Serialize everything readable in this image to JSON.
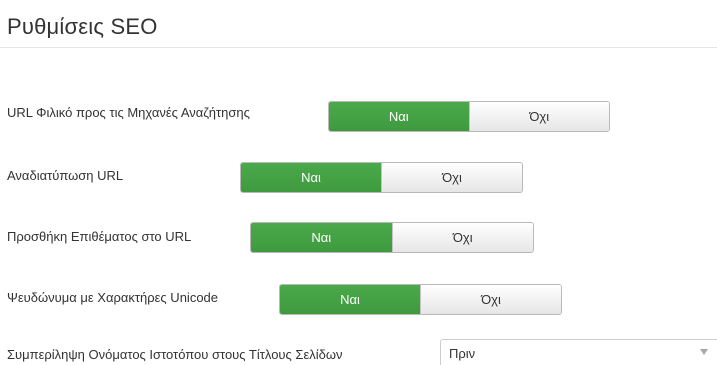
{
  "section": {
    "title": "Ρυθμίσεις SEO"
  },
  "colors": {
    "active": "#46a546",
    "inactive": "#f0f0f0"
  },
  "settings": [
    {
      "label": "URL Φιλικό προς τις Μηχανές Αναζήτησης",
      "yes_label": "Ναι",
      "no_label": "Όχι",
      "selected": "yes"
    },
    {
      "label": "Αναδιατύπωση URL",
      "yes_label": "Ναι",
      "no_label": "Όχι",
      "selected": "yes"
    },
    {
      "label": "Προσθήκη Επιθέματος στο URL",
      "yes_label": "Ναι",
      "no_label": "Όχι",
      "selected": "yes"
    },
    {
      "label": "Ψευδώνυμα με Χαρακτήρες Unicode",
      "yes_label": "Ναι",
      "no_label": "Όχι",
      "selected": "yes"
    }
  ],
  "site_name_in_titles": {
    "label": "Συμπερίληψη Ονόματος Ιστοτόπου στους Τίτλους Σελίδων",
    "value": "Πριν",
    "icon": "chevron-down-icon"
  }
}
